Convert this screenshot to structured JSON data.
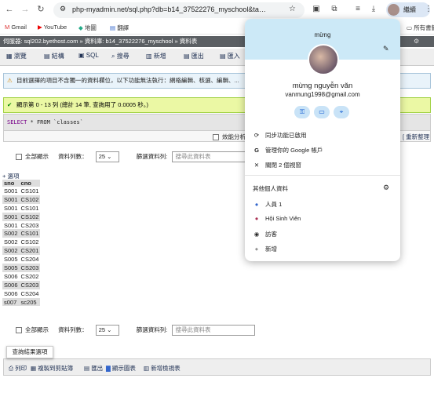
{
  "browser": {
    "url": "php-myadmin.net/sql.php?db=b14_37522276_myschool&ta…",
    "profile_chip_label": "繼續",
    "bookmarks": [
      "Gmail",
      "YouTube",
      "地圖",
      "翻譯"
    ],
    "all_bookmarks_label": "所有書籤"
  },
  "pma": {
    "breadcrumb": "伺服器: sql202.byethost.com » 資料庫: b14_37522276_myschool » 資料表",
    "tabs": [
      "瀏覽",
      "結構",
      "SQL",
      "搜尋",
      "新增",
      "匯出",
      "匯入"
    ],
    "warning": "目前選擇的項目不含獨一的資料欄位，以下功能無法執行：網格編輯、核選、編輯、...",
    "success": "顯示第 0 - 13 列 (總計 14 筆, 查詢用了 0.0005 秒。)",
    "sql_select": "SELECT",
    "sql_rest": "* FROM `classes`",
    "profiling_label": "效能分析",
    "refresh_label": "重新整理",
    "show_all_label": "全部顯示",
    "row_count_label": "資料列數：",
    "row_count_value": "25",
    "filter_label": "篩選資料列:",
    "filter_placeholder": "搜尋此資料表",
    "options_label": "+ 選項",
    "columns": [
      "sno",
      "cno"
    ],
    "rows": [
      [
        "S001",
        "CS101"
      ],
      [
        "S001",
        "CS102"
      ],
      [
        "S001",
        "CS101"
      ],
      [
        "S001",
        "CS102"
      ],
      [
        "S001",
        "CS203"
      ],
      [
        "S002",
        "CS101"
      ],
      [
        "S002",
        "CS102"
      ],
      [
        "S002",
        "CS201"
      ],
      [
        "S005",
        "CS204"
      ],
      [
        "S005",
        "CS203"
      ],
      [
        "S006",
        "CS202"
      ],
      [
        "S006",
        "CS203"
      ],
      [
        "S006",
        "CS204"
      ],
      [
        "s007",
        "sc205"
      ]
    ],
    "tooltip": "查詢結果選項",
    "ops": [
      "列印",
      "複製到剪貼簿",
      "匯出",
      "顯示圖表",
      "新增檢視表"
    ]
  },
  "profile": {
    "greeting": "mừng",
    "name": "mừng nguyễn văn",
    "email": "vanmung1998@gmail.com",
    "sync": "同步功能已啟用",
    "manage": "管理你的 Google 帳戶",
    "close_windows": "關閉 2 個視窗",
    "other_profiles_label": "其他個人資料",
    "profiles": [
      "人員 1",
      "Hội Sinh Viên",
      "訪客"
    ],
    "add_label": "新增"
  }
}
